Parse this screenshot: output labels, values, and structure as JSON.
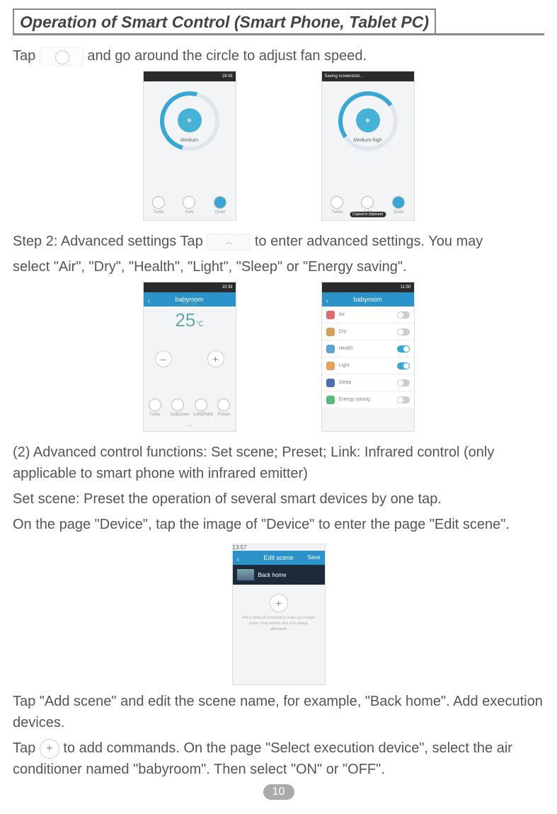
{
  "header": {
    "title": "Operation of Smart Control (Smart Phone, Tablet PC)"
  },
  "intro": {
    "tap": "Tap",
    "line1_rest": " and go around the circle to adjust fan speed."
  },
  "fanShots": {
    "left": {
      "label": "Medium",
      "time": "19:43",
      "buttons": [
        "Turbo",
        "Auto",
        "Quiet"
      ]
    },
    "right": {
      "label": "Medium-high",
      "buttons": [
        "Turbo",
        "Auto",
        "Quiet"
      ],
      "toast": "Copied to clipboard",
      "status": "Saving screenshot..."
    }
  },
  "step2": {
    "prefix": "Step 2: Advanced settings  Tap ",
    "mid": " to ",
    "suffix": "enter advanced settings. You may",
    "line2": "select \"Air\", \"Dry\", \"Health\", \"Light\", \"Sleep\" or \"Energy saving\"."
  },
  "mainShot": {
    "title": "babyroom",
    "cool": "❄ Cool",
    "temp": "25",
    "unit": "℃",
    "buttons": [
      "Turbo",
      "Up&Down",
      "Left&Right",
      "Preset"
    ],
    "time": "10:39"
  },
  "settingsShot": {
    "title": "babyroom",
    "time": "11:50",
    "items": [
      {
        "label": "Air",
        "color": "#e06a6a",
        "on": false
      },
      {
        "label": "Dry",
        "color": "#d6a25a",
        "on": false
      },
      {
        "label": "Health",
        "color": "#5aa4d6",
        "on": true
      },
      {
        "label": "Light",
        "color": "#e6a05a",
        "on": true
      },
      {
        "label": "Sleep",
        "color": "#4a6fb0",
        "on": false
      },
      {
        "label": "Energy saving",
        "color": "#5ab87a",
        "on": false
      }
    ]
  },
  "para2": {
    "l1": "(2) Advanced control functions: Set scene; Preset; Link: Infrared control (only applicable to smart phone with infrared emitter)",
    "l2": "Set scene: Preset the operation of several smart devices by one tap.",
    "l3": "On the page \"Device\", tap the image of \"Device\" to enter the page \"Edit scene\"."
  },
  "editScene": {
    "title": "Edit scene",
    "save": "Save",
    "name": "Back home",
    "hint": "Add a series of command to make up a unique scene. Only need to click it for startup afterwards",
    "time": "13:57"
  },
  "para3": {
    "l1": "Tap \"Add scene\" and edit the scene name, for example, \"Back home\". Add execution devices.",
    "l2a": "Tap ",
    "l2b": " to add commands. On the page \"Select execution device\", select the air conditioner named \"babyroom\". Then select \"ON\" or \"OFF\"."
  },
  "page": "10"
}
